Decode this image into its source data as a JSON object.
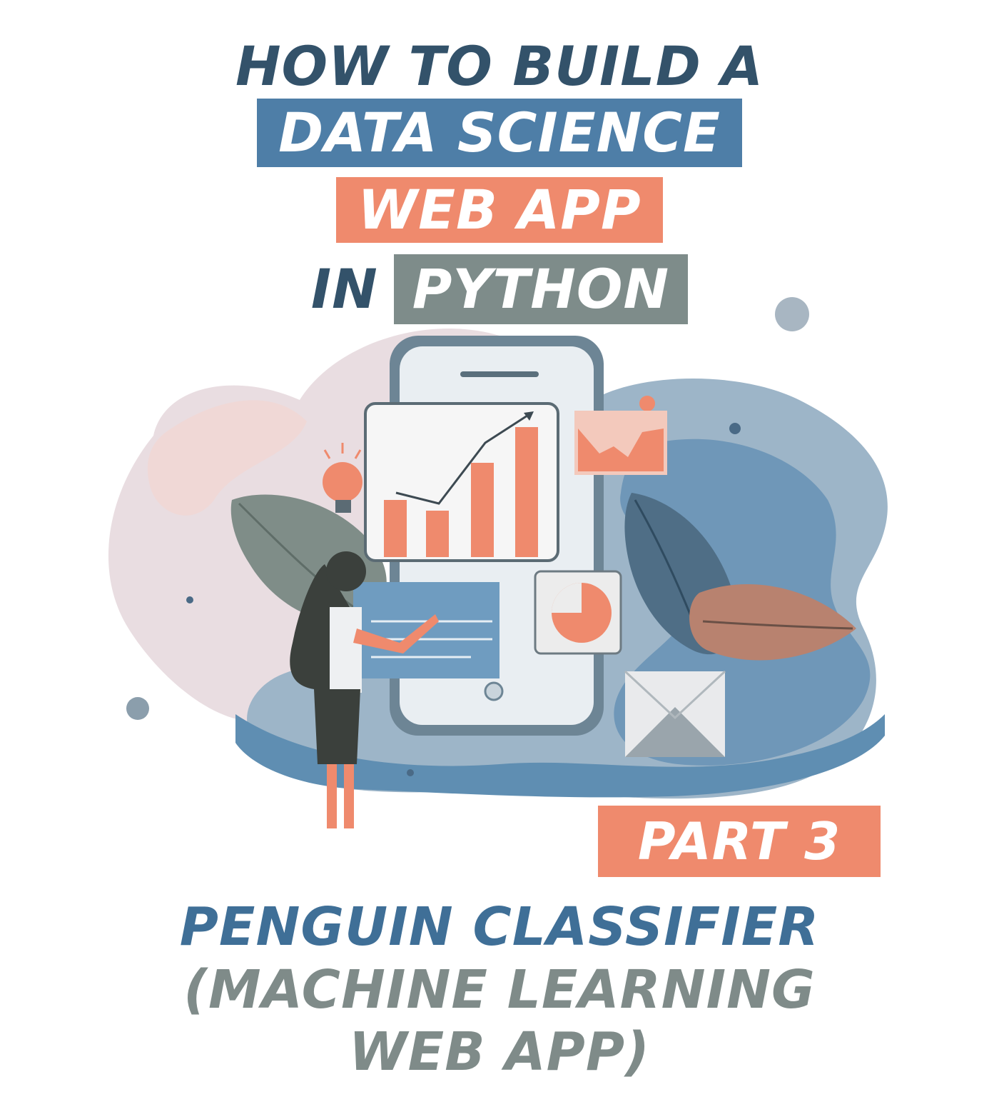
{
  "title": {
    "line1": "HOW TO BUILD A",
    "line2": "DATA SCIENCE",
    "line3": "WEB APP",
    "line4_plain": "IN",
    "line4_highlight": "PYTHON"
  },
  "badge": "PART 3",
  "subtitle": {
    "line1": "PENGUIN CLASSIFIER",
    "line2": "(MACHINE LEARNING",
    "line3": "WEB APP)"
  },
  "colors": {
    "dark_navy": "#33526a",
    "blue": "#4e7ea7",
    "salmon": "#ef8a6d",
    "gray": "#7e8c8a",
    "pink_blob": "#e9d8dc",
    "light_blue_blob": "#9fb7c9"
  }
}
